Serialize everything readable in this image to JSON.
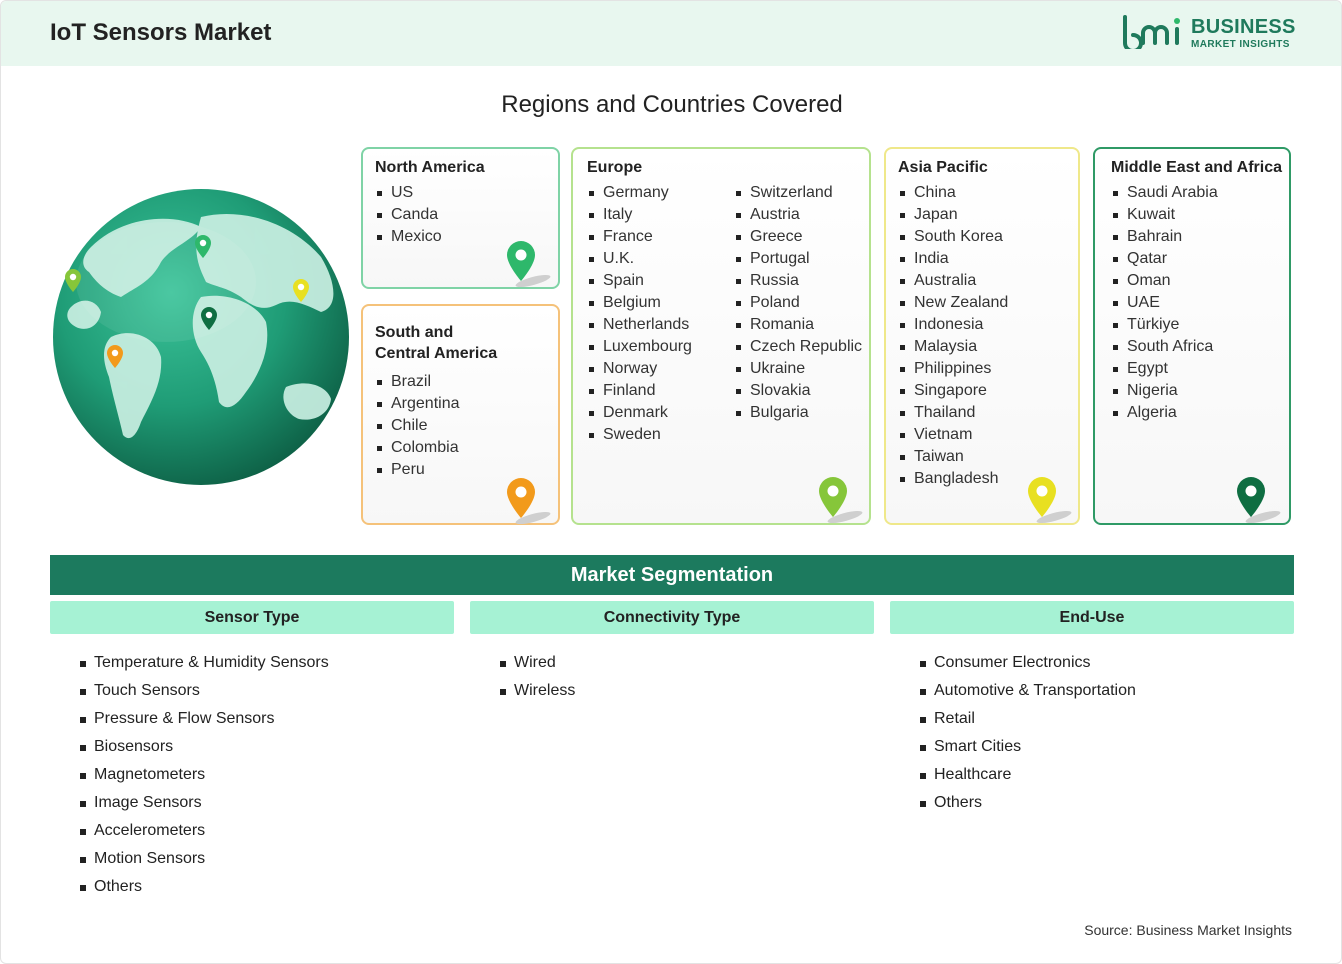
{
  "header": {
    "title": "IoT Sensors Market",
    "logo": {
      "line1": "BUSINESS",
      "line2": "MARKET INSIGHTS",
      "mark": "bmi"
    }
  },
  "regions_title": "Regions and Countries Covered",
  "regions": {
    "north_america": {
      "name": "North America",
      "countries": [
        "US",
        "Canda",
        "Mexico"
      ],
      "pin_color": "#2eb86b",
      "border": "#7fd3a6"
    },
    "south_central_america": {
      "name_line1": "South and",
      "name_line2": "Central America",
      "countries": [
        "Brazil",
        "Argentina",
        "Chile",
        "Colombia",
        "Peru"
      ],
      "pin_color": "#f29a1b",
      "border": "#f5c27a"
    },
    "europe": {
      "name": "Europe",
      "countries_col1": [
        "Germany",
        "Italy",
        "France",
        "U.K.",
        "Spain",
        "Belgium",
        "Netherlands",
        "Luxembourg",
        "Norway",
        "Finland",
        "Denmark",
        "Sweden"
      ],
      "countries_col2": [
        "Switzerland",
        "Austria",
        "Greece",
        "Portugal",
        "Russia",
        "Poland",
        "Romania",
        "Czech Republic",
        "Ukraine",
        "Slovakia",
        "Bulgaria"
      ],
      "pin_color": "#86c63a",
      "border": "#b5e28e"
    },
    "asia_pacific": {
      "name": "Asia Pacific",
      "countries": [
        "China",
        "Japan",
        "South Korea",
        "India",
        "Australia",
        "New Zealand",
        "Indonesia",
        "Malaysia",
        "Philippines",
        "Singapore",
        "Thailand",
        "Vietnam",
        "Taiwan",
        "Bangladesh"
      ],
      "pin_color": "#e8e021",
      "border": "#efe88a"
    },
    "middle_east_africa": {
      "name": "Middle East and Africa",
      "countries": [
        "Saudi Arabia",
        "Kuwait",
        "Bahrain",
        "Qatar",
        "Oman",
        "UAE",
        "Türkiye",
        "South Africa",
        "Egypt",
        "Nigeria",
        "Algeria"
      ],
      "pin_color": "#0f6e42",
      "border": "#2f9a66"
    }
  },
  "segmentation": {
    "title": "Market Segmentation",
    "columns": [
      {
        "heading": "Sensor Type",
        "items": [
          "Temperature & Humidity Sensors",
          "Touch Sensors",
          "Pressure & Flow Sensors",
          "Biosensors",
          "Magnetometers",
          "Image Sensors",
          "Accelerometers",
          "Motion Sensors",
          "Others"
        ]
      },
      {
        "heading": "Connectivity Type",
        "items": [
          "Wired",
          "Wireless"
        ]
      },
      {
        "heading": "End-Use",
        "items": [
          "Consumer Electronics",
          "Automotive & Transportation",
          "Retail",
          "Smart Cities",
          "Healthcare",
          "Others"
        ]
      }
    ]
  },
  "source": "Source: Business Market Insights",
  "colors": {
    "brand": "#1f7a5c",
    "header_bg": "#e8f7ef",
    "segment_bar": "#1c7a5e",
    "segment_head": "#a6f2d4"
  }
}
